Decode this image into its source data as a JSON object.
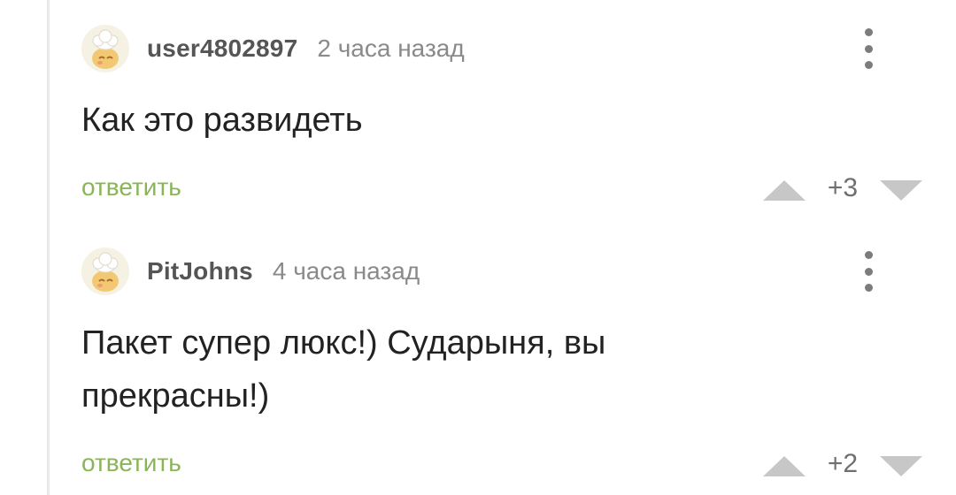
{
  "comments": [
    {
      "author": "user4802897",
      "time": "2 часа назад",
      "text": "Как это развидеть",
      "reply_label": "ответить",
      "rating": "+3",
      "avatar_icon": "default-avatar-cook-icon"
    },
    {
      "author": "PitJohns",
      "time": "4 часа назад",
      "text": "Пакет супер люкс!) Сударыня, вы прекрасны!)",
      "reply_label": "ответить",
      "rating": "+2",
      "avatar_icon": "default-avatar-cook-icon"
    }
  ],
  "colors": {
    "reply": "#8ab557",
    "vote_arrow": "#c7c7c7",
    "author": "#555555",
    "meta": "#8a8a8a",
    "body_text": "#222222",
    "thread_line": "#e9e9e9"
  },
  "icons": {
    "more": "vertical-ellipsis-icon",
    "upvote": "triangle-up-icon",
    "downvote": "triangle-down-icon"
  }
}
